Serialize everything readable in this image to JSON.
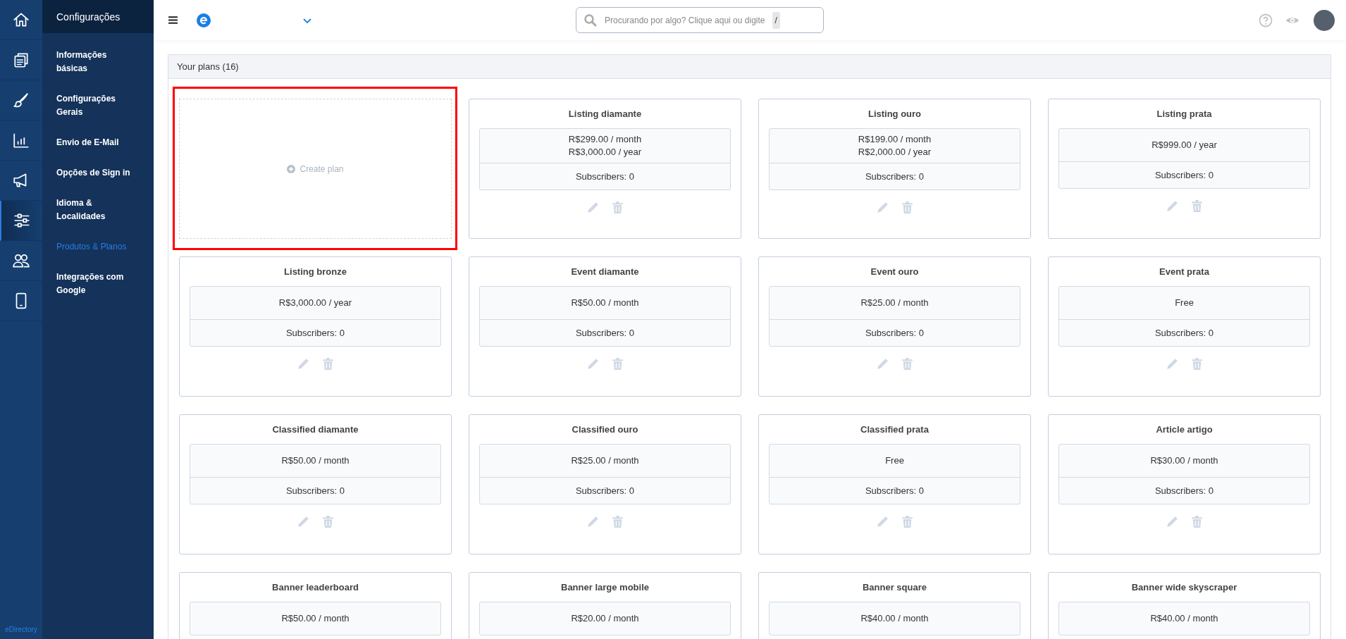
{
  "rail": [
    {
      "kind": "home",
      "selected": false
    },
    {
      "kind": "documents",
      "selected": false
    },
    {
      "kind": "brush",
      "selected": false
    },
    {
      "kind": "chart",
      "selected": false
    },
    {
      "kind": "megaphone",
      "selected": false
    },
    {
      "kind": "sliders",
      "selected": true
    },
    {
      "kind": "users",
      "selected": false
    },
    {
      "kind": "phone",
      "selected": false
    }
  ],
  "rail_footer": "eDirectory",
  "submenu": {
    "title": "Configurações",
    "items": [
      {
        "label": "Informações básicas",
        "selected": false
      },
      {
        "label": "Configurações Gerais",
        "selected": false
      },
      {
        "label": "Envio de E-Mail",
        "selected": false
      },
      {
        "label": "Opções de Sign in",
        "selected": false
      },
      {
        "label": "Idioma & Localidades",
        "selected": false
      },
      {
        "label": "Produtos & Planos",
        "selected": true
      },
      {
        "label": "Integrações com Google",
        "selected": false
      }
    ]
  },
  "search": {
    "placeholder": "Procurando por algo? Clique aqui ou digite",
    "key": "/"
  },
  "panel": {
    "title": "Your plans (16)",
    "plans": [
      {
        "kind": "create",
        "label": "Create plan",
        "highlighted": true
      },
      {
        "kind": "plan",
        "name": "Listing diamante",
        "prices": [
          "R$299.00 / month",
          "R$3,000.00 / year"
        ],
        "subscribers": "Subscribers: 0"
      },
      {
        "kind": "plan",
        "name": "Listing ouro",
        "prices": [
          "R$199.00 / month",
          "R$2,000.00 / year"
        ],
        "subscribers": "Subscribers: 0"
      },
      {
        "kind": "plan",
        "name": "Listing prata",
        "prices": [
          "R$999.00 / year"
        ],
        "subscribers": "Subscribers: 0"
      },
      {
        "kind": "plan",
        "name": "Listing bronze",
        "prices": [
          "R$3,000.00 / year"
        ],
        "subscribers": "Subscribers: 0"
      },
      {
        "kind": "plan",
        "name": "Event diamante",
        "prices": [
          "R$50.00 / month"
        ],
        "subscribers": "Subscribers: 0"
      },
      {
        "kind": "plan",
        "name": "Event ouro",
        "prices": [
          "R$25.00 / month"
        ],
        "subscribers": "Subscribers: 0"
      },
      {
        "kind": "plan",
        "name": "Event prata",
        "prices": [
          "Free"
        ],
        "subscribers": "Subscribers: 0"
      },
      {
        "kind": "plan",
        "name": "Classified diamante",
        "prices": [
          "R$50.00 / month"
        ],
        "subscribers": "Subscribers: 0"
      },
      {
        "kind": "plan",
        "name": "Classified ouro",
        "prices": [
          "R$25.00 / month"
        ],
        "subscribers": "Subscribers: 0"
      },
      {
        "kind": "plan",
        "name": "Classified prata",
        "prices": [
          "Free"
        ],
        "subscribers": "Subscribers: 0"
      },
      {
        "kind": "plan",
        "name": "Article artigo",
        "prices": [
          "R$30.00 / month"
        ],
        "subscribers": "Subscribers: 0"
      },
      {
        "kind": "plan",
        "name": "Banner leaderboard",
        "prices": [
          "R$50.00 / month"
        ]
      },
      {
        "kind": "plan",
        "name": "Banner large mobile",
        "prices": [
          "R$20.00 / month"
        ]
      },
      {
        "kind": "plan",
        "name": "Banner square",
        "prices": [
          "R$40.00 / month"
        ]
      },
      {
        "kind": "plan",
        "name": "Banner wide skyscraper",
        "prices": [
          "R$40.00 / month"
        ]
      }
    ]
  }
}
